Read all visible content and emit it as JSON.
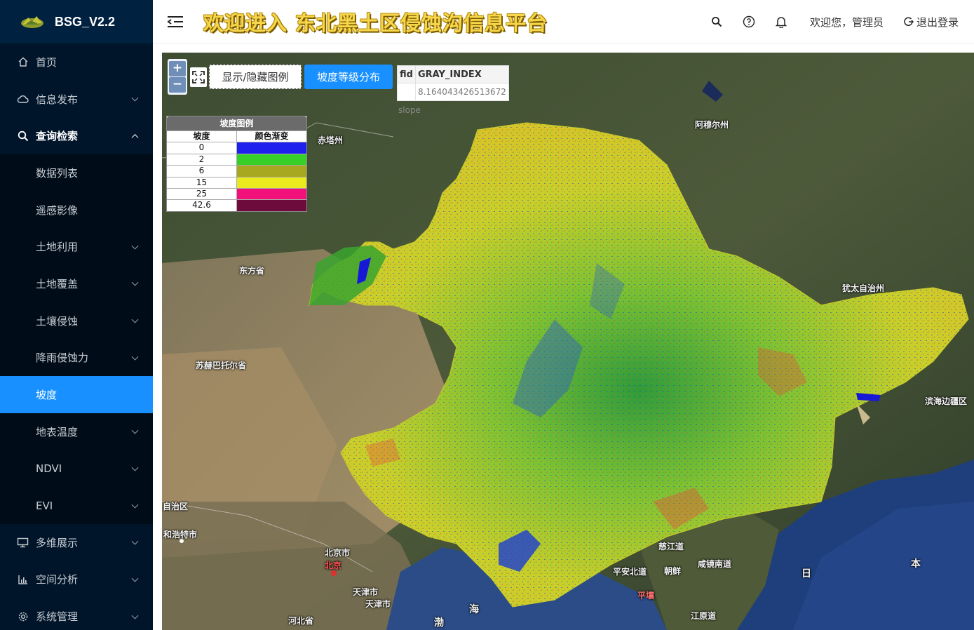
{
  "app": {
    "title": "BSG_V2.2"
  },
  "header": {
    "banner": "欢迎进入 东北黑土区侵蚀沟信息平台",
    "welcome": "欢迎您，管理员",
    "logout": "退出登录",
    "icons": [
      "search-icon",
      "help-icon",
      "bell-icon"
    ]
  },
  "sidebar": {
    "home": "首页",
    "info_publish": "信息发布",
    "query": "查询检索",
    "data_list": "数据列表",
    "remote_sensing": "遥感影像",
    "land_use": "土地利用",
    "land_cover": "土地覆盖",
    "soil_erosion": "土壤侵蚀",
    "rain_erosivity": "降雨侵蚀力",
    "slope": "坡度",
    "surface_temp": "地表温度",
    "ndvi": "NDVI",
    "evi": "EVI",
    "multi_view": "多维展示",
    "spatial_analysis": "空间分析",
    "system_mgmt": "系统管理"
  },
  "map": {
    "zoom_in": "+",
    "zoom_out": "−",
    "toggle_legend": "显示/隐藏图例",
    "slope_distribution": "坡度等级分布",
    "info": {
      "col1": "fid",
      "col2": "GRAY_INDEX",
      "value": "8.164043426513672"
    },
    "layer_tag": "slope",
    "legend": {
      "title": "坡度图例",
      "col1": "坡度",
      "col2": "颜色渐变",
      "rows": [
        {
          "value": "0",
          "color": "#1f1fee"
        },
        {
          "value": "2",
          "color": "#37d029"
        },
        {
          "value": "6",
          "color": "#a8a820"
        },
        {
          "value": "15",
          "color": "#eaea1f"
        },
        {
          "value": "25",
          "color": "#f2107a"
        },
        {
          "value": "42.6",
          "color": "#6e0b3d"
        }
      ]
    },
    "place_labels": {
      "chifeng": "赤塔州",
      "amur": "阿穆尔州",
      "dongfang": "东方省",
      "jewish": "犹太自治州",
      "sukhbaatar": "苏赫巴托尔省",
      "primorsky": "滨海边疆区",
      "autonomous": "自治区",
      "hohhot": "和浩特市",
      "beijing_city": "北京市",
      "beijing": "北京",
      "tianjin_city": "天津市",
      "tianjin": "天津市",
      "hebei": "河北省",
      "cijiang": "慈江道",
      "pyongan_north": "平安北道",
      "north_korea": "朝鲜",
      "hamgyong_south": "咸镜南道",
      "pyongyang": "平壤",
      "gangwon": "江原道",
      "sea1": "海",
      "sea2": "渤",
      "japan1": "日",
      "japan2": "本"
    }
  }
}
